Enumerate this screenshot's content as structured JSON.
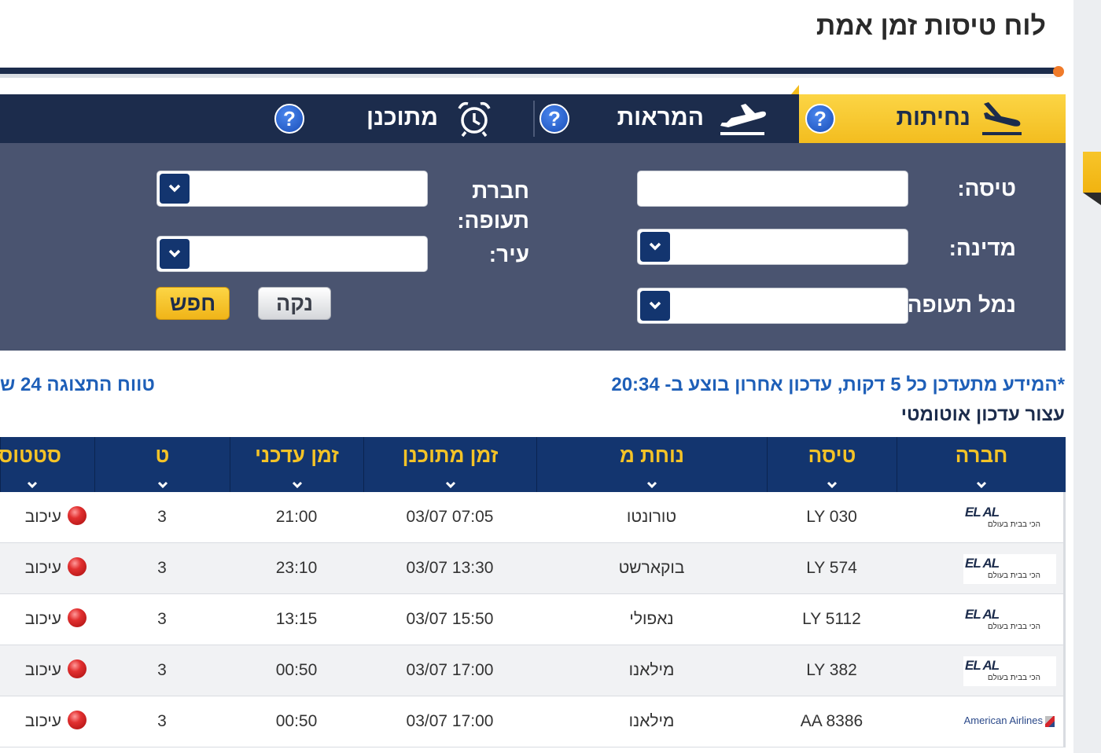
{
  "page": {
    "title": "לוח טיסות זמן אמת"
  },
  "tabs": [
    {
      "label": "נחיתות",
      "icon": "plane-landing-icon",
      "active": true
    },
    {
      "label": "המראות",
      "icon": "plane-takeoff-icon",
      "active": false
    },
    {
      "label": "מתוכנן",
      "icon": "alarm-clock-icon",
      "active": false
    }
  ],
  "help_symbol": "?",
  "search": {
    "flight_label": "טיסה:",
    "country_label": "מדינה:",
    "terminal_label": "נמל תעופה:",
    "airline_label": "חברת תעופה:",
    "city_label": "עיר:",
    "flight_value": "",
    "country_value": "",
    "terminal_value": "",
    "airline_value": "",
    "city_value": "",
    "clear_label": "נקה",
    "search_label": "חפש"
  },
  "info": {
    "update_notice": "*המידע מתעדכן כל 5 דקות, עדכון אחרון בוצע ב- 20:34",
    "range_notice": "טווח התצוגה 24 ש",
    "stop_auto_update": "עצור עדכון אוטומטי"
  },
  "table": {
    "columns": [
      "חברה",
      "טיסה",
      "נוחת מ",
      "זמן מתוכנן",
      "זמן עדכני",
      "ט",
      "סטטוס"
    ],
    "rows": [
      {
        "airline_logo": "elal-logo",
        "airline_text": "EL AL",
        "slogan": "הכי בבית בעולם",
        "flight": "LY 030",
        "from": "טורונטו",
        "scheduled": "03/07 07:05",
        "updated": "21:00",
        "terminal": "3",
        "status": "עיכוב"
      },
      {
        "airline_logo": "elal-logo",
        "airline_text": "EL AL",
        "slogan": "הכי בבית בעולם",
        "flight": "LY 574",
        "from": "בוקארשט",
        "scheduled": "03/07 13:30",
        "updated": "23:10",
        "terminal": "3",
        "status": "עיכוב"
      },
      {
        "airline_logo": "elal-logo",
        "airline_text": "EL AL",
        "slogan": "הכי בבית בעולם",
        "flight": "LY 5112",
        "from": "נאפולי",
        "scheduled": "03/07 15:50",
        "updated": "13:15",
        "terminal": "3",
        "status": "עיכוב"
      },
      {
        "airline_logo": "elal-logo",
        "airline_text": "EL AL",
        "slogan": "הכי בבית בעולם",
        "flight": "LY 382",
        "from": "מילאנו",
        "scheduled": "03/07 17:00",
        "updated": "00:50",
        "terminal": "3",
        "status": "עיכוב"
      },
      {
        "airline_logo": "american-airlines-logo",
        "airline_text": "American Airlines",
        "slogan": "",
        "flight": "AA 8386",
        "from": "מילאנו",
        "scheduled": "03/07 17:00",
        "updated": "00:50",
        "terminal": "3",
        "status": "עיכוב"
      }
    ]
  },
  "colors": {
    "navy": "#1c2c4c",
    "header_navy": "#13356f",
    "accent_yellow": "#f4c327",
    "panel": "#4a5470",
    "link_blue": "#1e5fb8",
    "delay_red": "#e23030"
  }
}
